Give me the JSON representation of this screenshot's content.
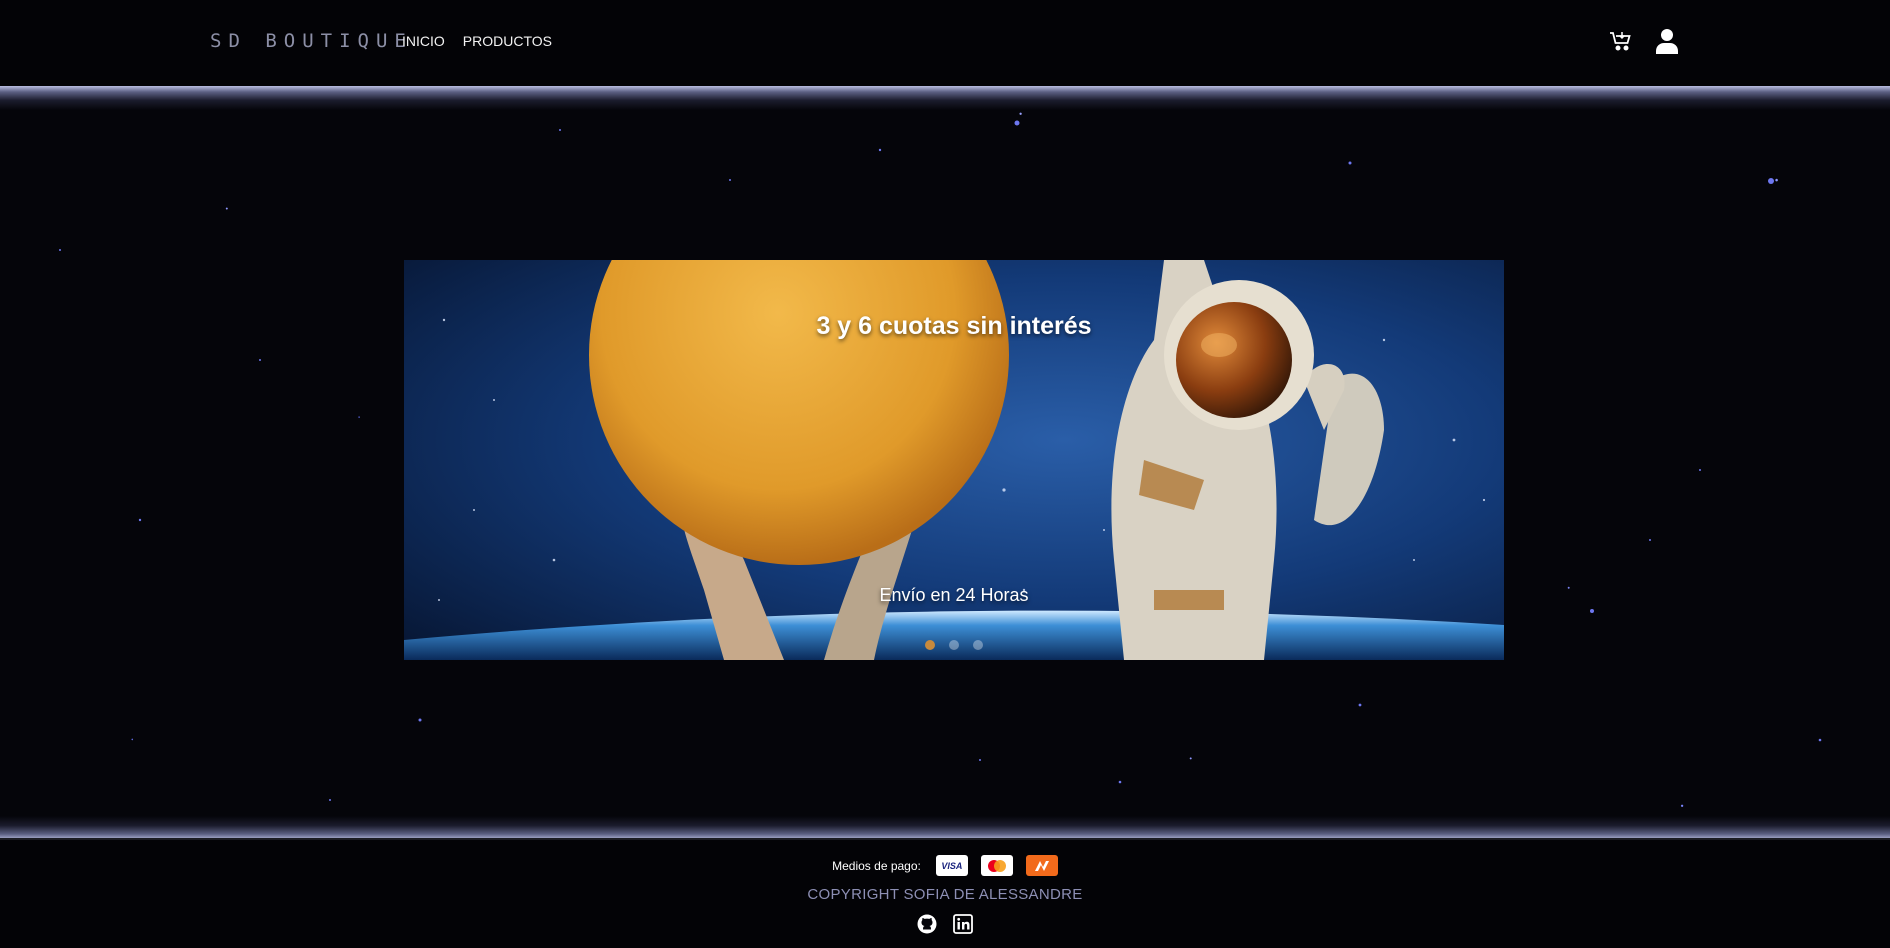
{
  "header": {
    "brand": "SD BOUTIQUE",
    "nav": [
      {
        "label": "INICIO"
      },
      {
        "label": "PRODUCTOS"
      }
    ],
    "cart_icon": "cart-icon",
    "user_icon": "user-icon"
  },
  "carousel": {
    "title": "3 y 6 cuotas sin interés",
    "subtitle": "Envío en 24 Horas",
    "slides_count": 3,
    "active_slide": 1
  },
  "footer": {
    "payment_label": "Medios de pago:",
    "payment_methods": [
      {
        "name": "visa",
        "label": "VISA"
      },
      {
        "name": "mastercard",
        "label": ""
      },
      {
        "name": "naranja",
        "label": ""
      }
    ],
    "copyright": "COPYRIGHT SOFIA DE ALESSANDRE",
    "social_icons": [
      "github-icon",
      "linkedin-icon"
    ]
  },
  "colors": {
    "background": "#05050a",
    "brand_text": "#8c8fa6",
    "copyright_text": "#8d8fb4",
    "indicator_active": "#c88a3d",
    "naranja_card": "#f26a1b"
  }
}
